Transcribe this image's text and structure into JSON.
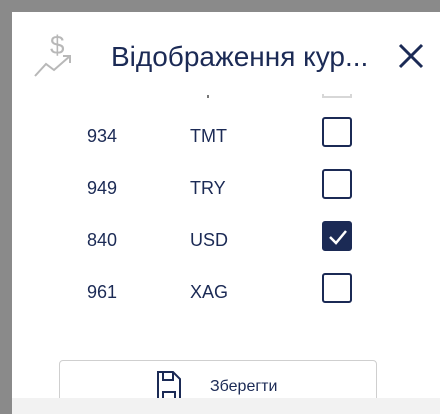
{
  "dialog": {
    "title": "Відображення кур...",
    "icon": "dollar-chart-icon",
    "close_icon": "close-icon"
  },
  "currencies": [
    {
      "code": "934",
      "currency": "TMT",
      "checked": false
    },
    {
      "code": "949",
      "currency": "TRY",
      "checked": false
    },
    {
      "code": "840",
      "currency": "USD",
      "checked": true
    },
    {
      "code": "961",
      "currency": "XAG",
      "checked": false
    }
  ],
  "save_button": {
    "label": "Зберегти",
    "icon": "save-icon"
  },
  "colors": {
    "accent": "#1b2a55",
    "frame": "#8a8a8a"
  }
}
